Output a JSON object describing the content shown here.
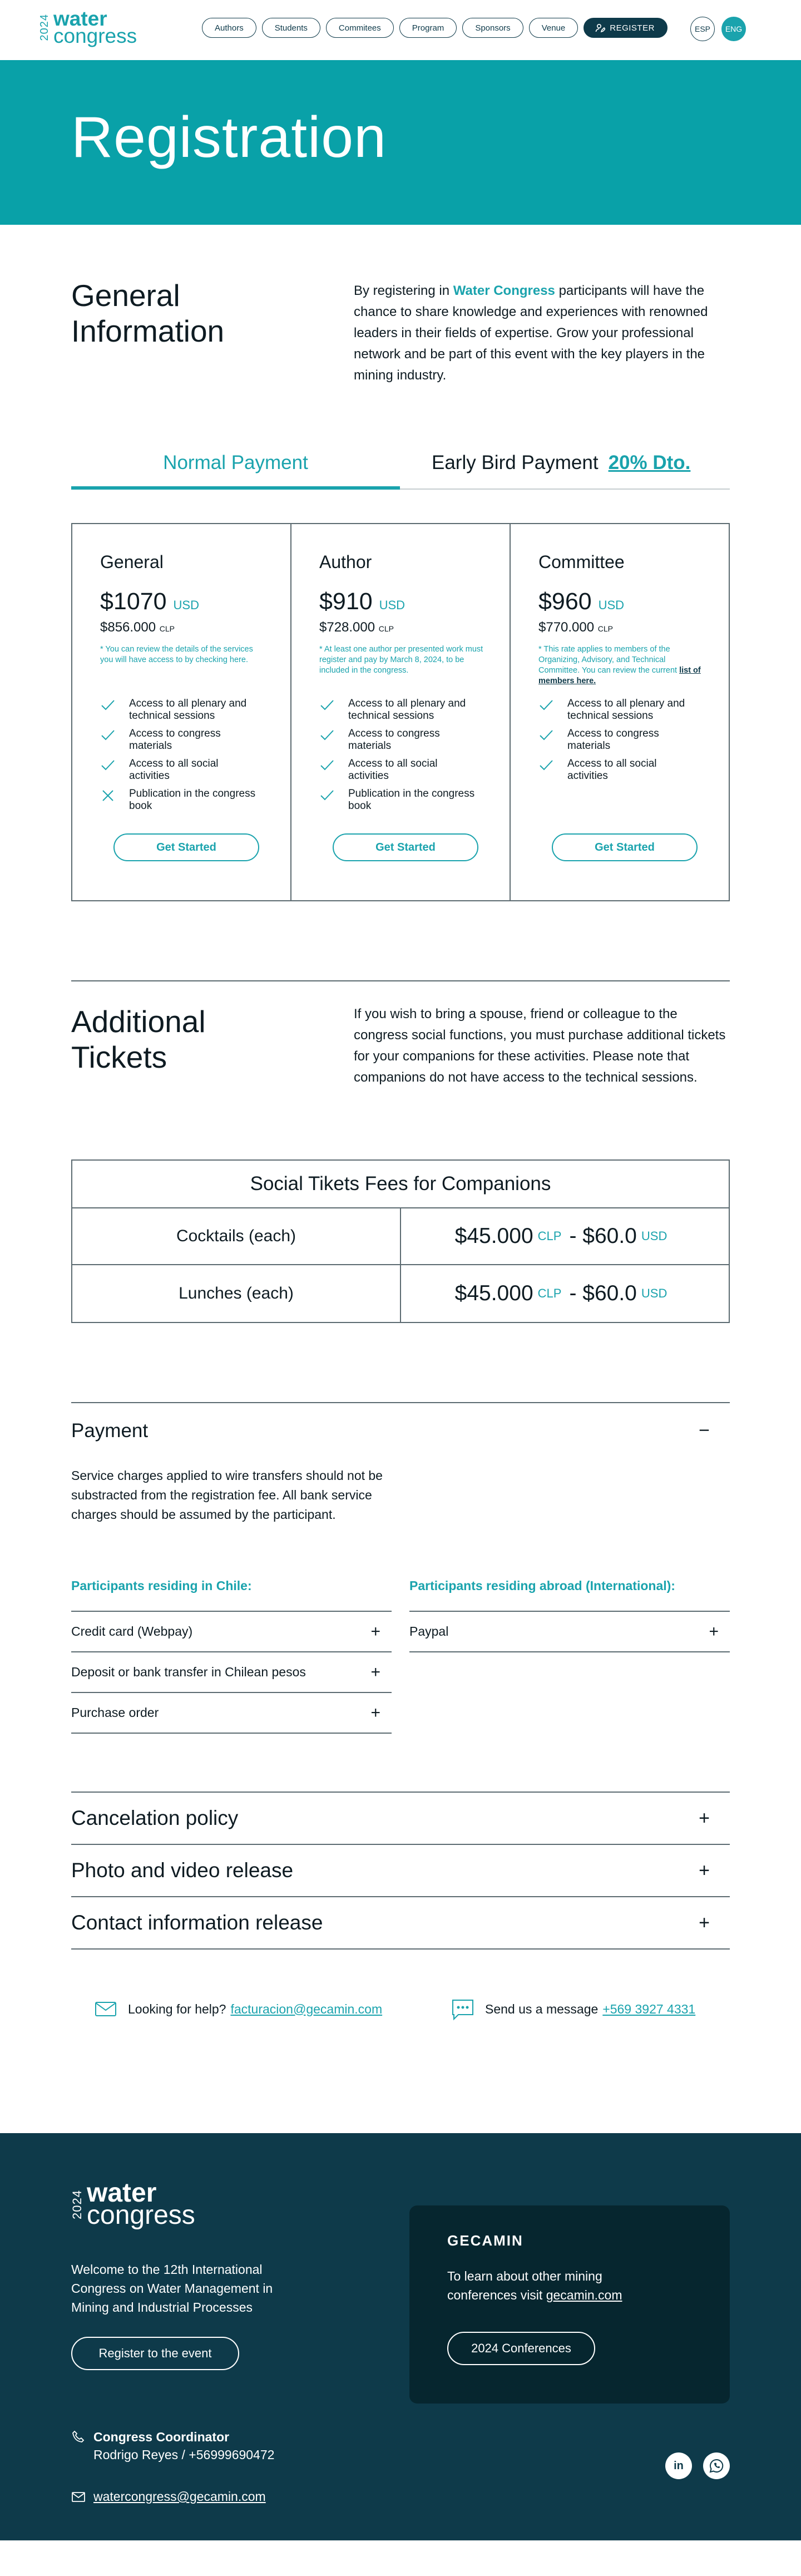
{
  "header": {
    "logo_year": "2024",
    "logo_line1": "water",
    "logo_line2": "congress",
    "nav": [
      "Authors",
      "Students",
      "Commitees",
      "Program",
      "Sponsors",
      "Venue"
    ],
    "register_label": "REGISTER",
    "lang_esp": "ESP",
    "lang_eng": "ENG"
  },
  "hero": {
    "title": "Registration"
  },
  "general_info": {
    "title": "General Information",
    "text_before": "By registering in ",
    "highlight": "Water Congress",
    "text_after": " participants will have the chance to share knowledge and experiences with renowned leaders in their fields of expertise. Grow your professional network and be part of this event with the key players in the mining industry."
  },
  "tabs": {
    "normal": "Normal Payment",
    "early": "Early Bird Payment",
    "early_discount": "20% Dto."
  },
  "plans": [
    {
      "name": "General",
      "usd": "$1070",
      "usd_cur": "USD",
      "clp": "$856.000",
      "clp_cur": "CLP",
      "note": "* You can review the details of the services you will have access to by checking here.",
      "note_link": "",
      "features": [
        {
          "text": "Access to all plenary and technical sessions",
          "included": true
        },
        {
          "text": "Access to congress materials",
          "included": true
        },
        {
          "text": "Access to all social activities",
          "included": true
        },
        {
          "text": "Publication in the congress book",
          "included": false
        }
      ],
      "button": "Get Started"
    },
    {
      "name": "Author",
      "usd": "$910",
      "usd_cur": "USD",
      "clp": "$728.000",
      "clp_cur": "CLP",
      "note": "* At least one author per presented work must register and pay by March 8, 2024, to be included in the congress.",
      "note_link": "",
      "features": [
        {
          "text": "Access to all plenary and technical sessions",
          "included": true
        },
        {
          "text": "Access to congress materials",
          "included": true
        },
        {
          "text": "Access to all social activities",
          "included": true
        },
        {
          "text": "Publication in the congress book",
          "included": true
        }
      ],
      "button": "Get Started"
    },
    {
      "name": "Committee",
      "usd": "$960",
      "usd_cur": "USD",
      "clp": "$770.000",
      "clp_cur": "CLP",
      "note": "* This rate applies to members of the Organizing, Advisory, and Technical Committee. You can review the current ",
      "note_link": "list of members here.",
      "features": [
        {
          "text": "Access to all plenary and technical sessions",
          "included": true
        },
        {
          "text": "Access to congress materials",
          "included": true
        },
        {
          "text": "Access to all social activities",
          "included": true
        }
      ],
      "button": "Get Started"
    }
  ],
  "additional": {
    "title": "Additional Tickets",
    "text": "If you wish to bring a spouse, friend or colleague to the congress social functions, you must purchase additional tickets for your companions for these activities. Please note that companions do not have access to the technical sessions."
  },
  "fees": {
    "title": "Social Tikets Fees for Companions",
    "rows": [
      {
        "label": "Cocktails (each)",
        "clp": "$45.000",
        "clp_cur": "CLP",
        "sep": "-",
        "usd": "$60.0",
        "usd_cur": "USD"
      },
      {
        "label": "Lunches (each)",
        "clp": "$45.000",
        "clp_cur": "CLP",
        "sep": "-",
        "usd": "$60.0",
        "usd_cur": "USD"
      }
    ]
  },
  "payment": {
    "title": "Payment",
    "toggle": "−",
    "description": "Service charges applied to wire transfers should not be substracted from the registration fee. All bank service charges should be assumed by the participant.",
    "chile_title": "Participants residing in Chile:",
    "chile_items": [
      "Credit card (Webpay)",
      "Deposit or bank transfer in Chilean pesos",
      "Purchase order"
    ],
    "intl_title": "Participants residing abroad (International):",
    "intl_items": [
      "Paypal"
    ],
    "plus": "+"
  },
  "accordions": [
    "Cancelation policy",
    "Photo and video release",
    "Contact information release"
  ],
  "help": {
    "email_label": "Looking for help?",
    "email": "facturacion@gecamin.com",
    "phone_label": "Send us a message",
    "phone": "+569 3927 4331"
  },
  "footer": {
    "welcome": "Welcome to the 12th International Congress on Water Management in Mining and Industrial Processes",
    "register_button": "Register to the event",
    "card_title": "GECAMIN",
    "card_text": "To learn about other mining conferences visit ",
    "card_link": "gecamin.com",
    "card_button": "2024 Conferences",
    "coordinator_title": "Congress Coordinator",
    "coordinator_name": "Rodrigo Reyes / +56999690472",
    "email": "watercongress@gecamin.com",
    "linkedin": "in"
  },
  "colors": {
    "teal": "#1aa3ad",
    "hero": "#09a1a8",
    "navy": "#0e3a4a",
    "card": "#06262f"
  }
}
